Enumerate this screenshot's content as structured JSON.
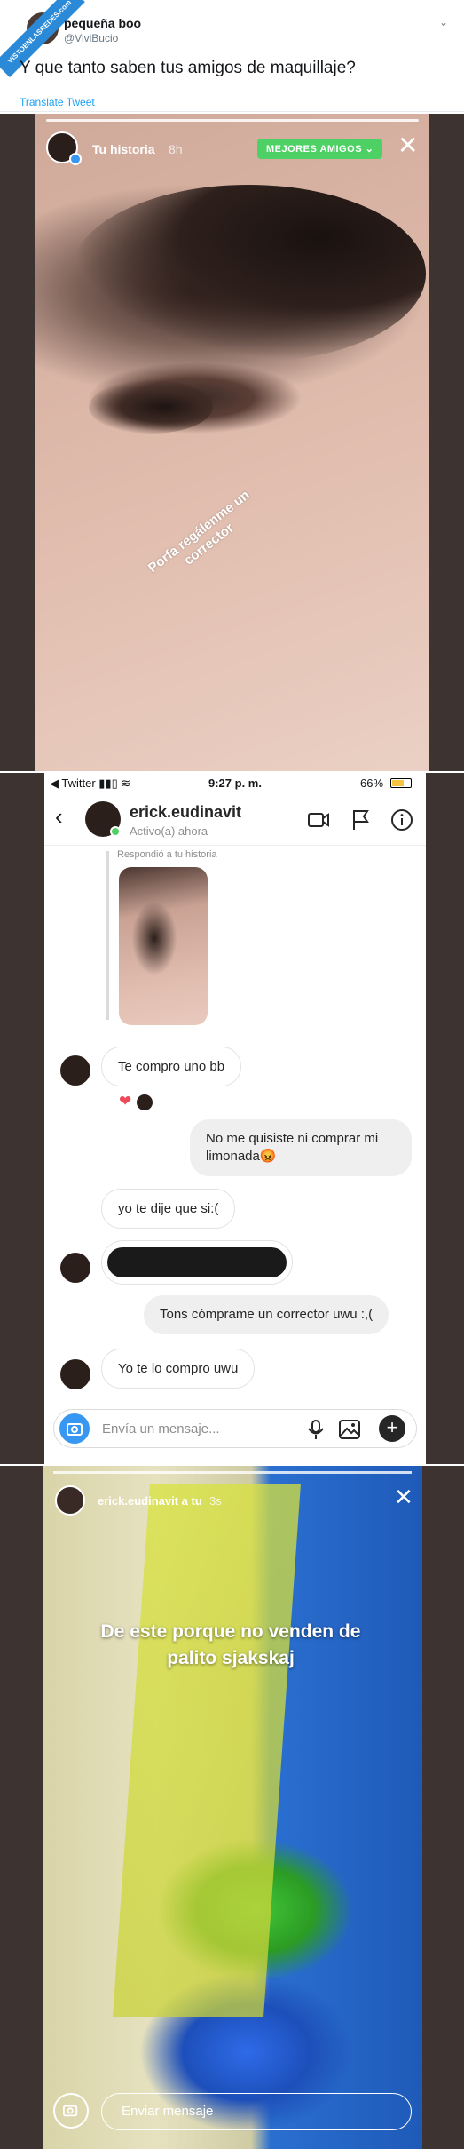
{
  "watermark": "VISTOENLASREDES.com",
  "tweet": {
    "name": "pequeña boo",
    "handle": "@ViviBucio",
    "text": "Y que tanto saben tus amigos de maquillaje?",
    "translate": "Translate Tweet"
  },
  "story1": {
    "title": "Tu historia",
    "time": "8h",
    "best_friends": "MEJORES AMIGOS",
    "caption": "Porfa regálenme un corrector"
  },
  "dm": {
    "status": {
      "carrier": "Twitter",
      "time": "9:27 p. m.",
      "battery": "66%",
      "battery_level": 0.66
    },
    "username": "erick.eudinavit",
    "activity": "Activo(a) ahora",
    "reply_label": "Respondió a tu historia",
    "messages": [
      {
        "from": "them",
        "text": "Te compro uno bb"
      },
      {
        "from": "me",
        "text": "No me quisiste ni comprar mi limonada😡"
      },
      {
        "from": "them",
        "text": "yo te dije que si:("
      },
      {
        "from": "them",
        "text": ""
      },
      {
        "from": "me",
        "text": "Tons cómprame un corrector uwu :,("
      },
      {
        "from": "them",
        "text": "Yo te lo compro uwu"
      }
    ],
    "composer_placeholder": "Envía un mensaje..."
  },
  "story2": {
    "username": "erick.eudinavit a tu",
    "time": "3s",
    "caption": "De este porque no venden de palito sjakskaj",
    "send_placeholder": "Enviar mensaje"
  }
}
